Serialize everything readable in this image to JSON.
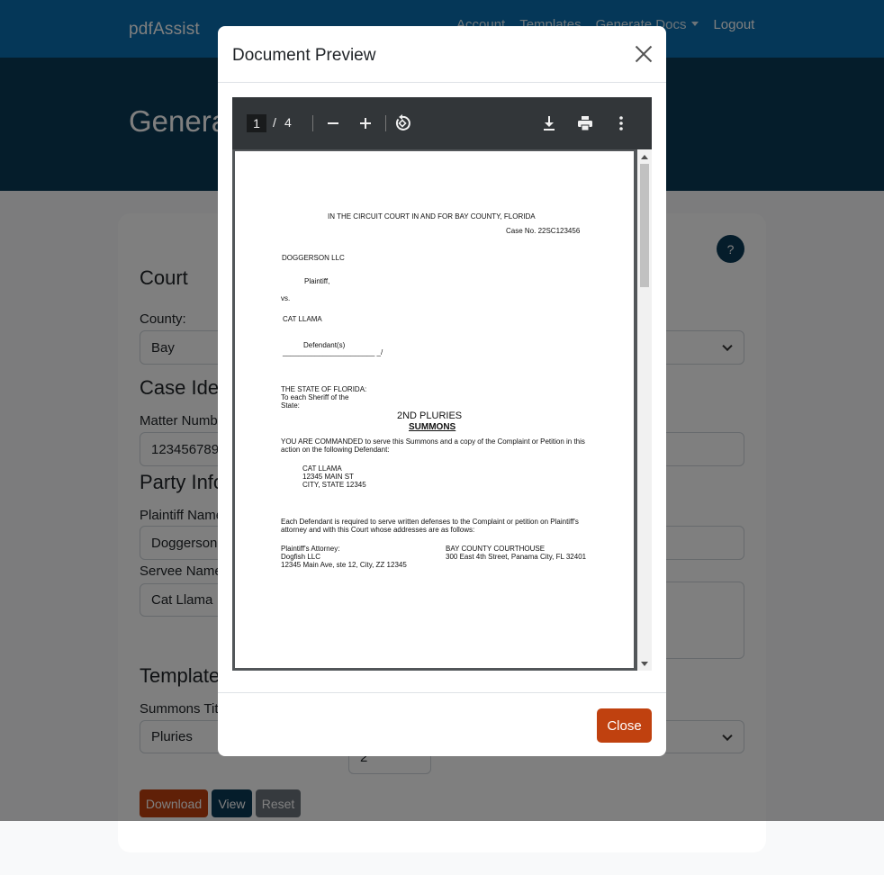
{
  "navbar": {
    "brand": "pdfAssist",
    "links": [
      "Account",
      "Templates",
      "Generate Docs",
      "Logout"
    ]
  },
  "hero": {
    "title": "Generate Documents"
  },
  "form": {
    "help_label": "?",
    "court_heading": "Court",
    "county_label": "County:",
    "county_value": "Bay",
    "case_heading": "Case Identification",
    "matter_label": "Matter Number:",
    "matter_value": "123456789",
    "party_heading": "Party Information",
    "plaintiff_label": "Plaintiff Name:",
    "plaintiff_value": "Doggerson LLC",
    "servee_label": "Servee Name:",
    "servee_value": "Cat Llama",
    "template_heading": "Template",
    "summons_label": "Summons Title:",
    "summons_value": "Pluries",
    "number_value": "2",
    "buttons": {
      "download": "Download",
      "view": "View",
      "reset": "Reset"
    }
  },
  "modal": {
    "title": "Document Preview",
    "close_label": "Close",
    "viewer": {
      "current_page": "1",
      "separator": "/",
      "total_pages": "4",
      "scroll_fraction": 0.0
    },
    "document": {
      "court": "IN THE CIRCUIT COURT IN AND FOR BAY COUNTY, FLORIDA",
      "case_no": "Case No. 22SC123456",
      "plaintiff_name": "DOGGERSON LLC",
      "plaintiff_role": "Plaintiff,",
      "vs": "vs.",
      "defendant_name": "CAT LLAMA",
      "defendant_role": "Defendant(s)",
      "signature_line": "_______________________ _/",
      "state_line1": "THE STATE OF FLORIDA:",
      "state_line2": "To each Sheriff of the",
      "state_line3": "State:",
      "title1": "2ND PLURIES",
      "title2": "SUMMONS",
      "command_line1": "YOU ARE COMMANDED to serve this Summons and a copy of the Complaint or Petition in this",
      "command_line2": "action on the following Defendant:",
      "addr1": "CAT LLAMA",
      "addr2": "12345 MAIN ST",
      "addr3": "CITY, STATE 12345",
      "defense_line1": "Each Defendant is required to serve written defenses to the Complaint or petition on Plaintiff's",
      "defense_line2": "attorney and with this Court whose addresses are as follows:",
      "attorney_label": "Plaintiff's Attorney:",
      "attorney_name": "Dogfish LLC",
      "attorney_addr": "12345 Main Ave, ste 12, City, ZZ 12345",
      "courthouse_name": "BAY COUNTY COURTHOUSE",
      "courthouse_addr": "300 East 4th Street, Panama City, FL 32401"
    }
  },
  "colors": {
    "navbar": "#0a6fb0",
    "hero": "#0b3a57",
    "download_button": "#c0410f",
    "view_button": "#0b3a57",
    "reset_button": "#6c757d",
    "close_button": "#c0410f",
    "viewer_toolbar": "#323639",
    "viewer_background": "#525659"
  }
}
